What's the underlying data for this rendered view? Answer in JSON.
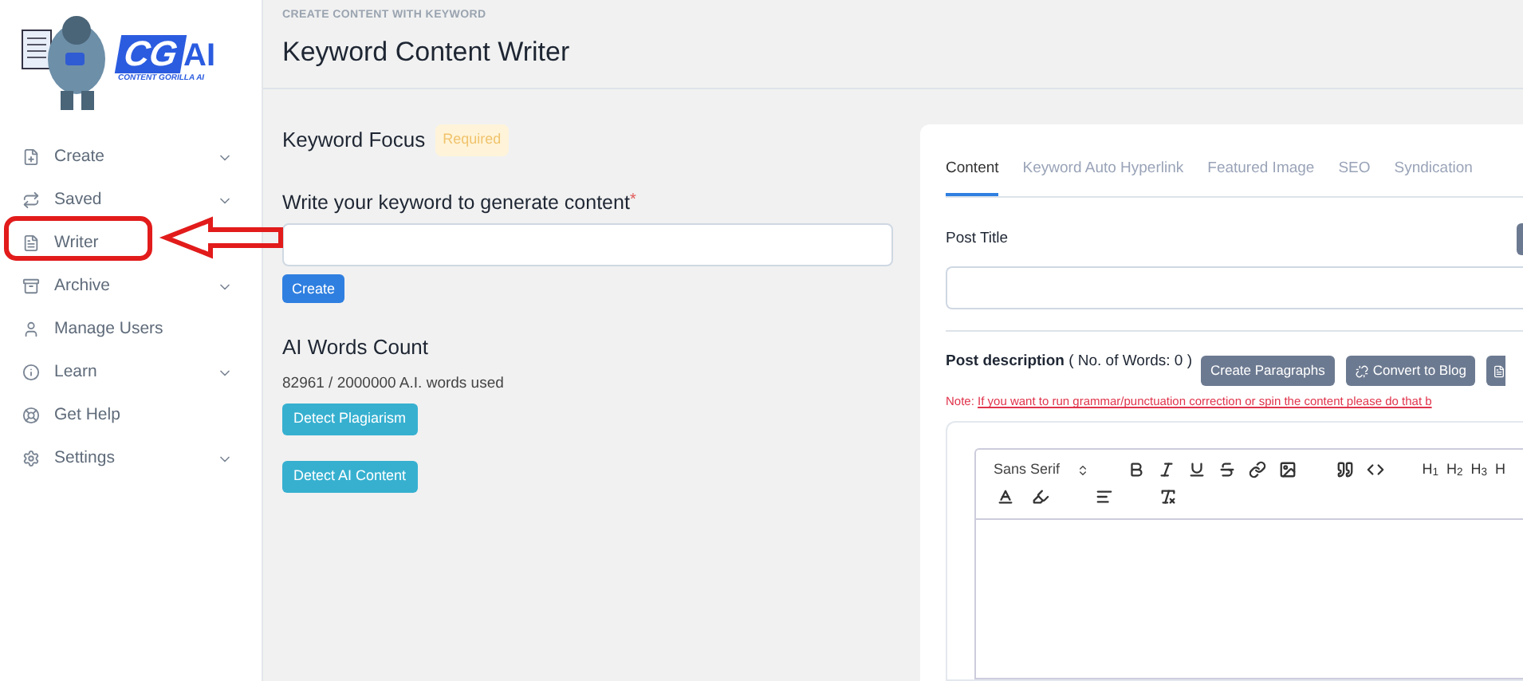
{
  "logo": {
    "mark": "CG",
    "suffix": "AI",
    "tagline": "CONTENT GORILLA AI"
  },
  "sidebar": {
    "items": [
      {
        "label": "Create",
        "has_submenu": true
      },
      {
        "label": "Saved",
        "has_submenu": true
      },
      {
        "label": "Writer",
        "has_submenu": false
      },
      {
        "label": "Archive",
        "has_submenu": true
      },
      {
        "label": "Manage Users",
        "has_submenu": false
      },
      {
        "label": "Learn",
        "has_submenu": true
      },
      {
        "label": "Get Help",
        "has_submenu": false
      },
      {
        "label": "Settings",
        "has_submenu": true
      }
    ]
  },
  "header": {
    "overline": "CREATE CONTENT WITH KEYWORD",
    "title": "Keyword Content Writer"
  },
  "keyword_focus": {
    "title": "Keyword Focus",
    "badge": "Required",
    "field_label": "Write your keyword to generate content",
    "required_mark": "*",
    "create_button": "Create"
  },
  "words_count": {
    "title": "AI Words Count",
    "usage": "82961 / 2000000 A.I. words used",
    "buttons": [
      "Detect Plagiarism",
      "Detect AI Content"
    ]
  },
  "editor_panel": {
    "tabs": [
      {
        "label": "Content",
        "selected": true
      },
      {
        "label": "Keyword Auto Hyperlink",
        "selected": false
      },
      {
        "label": "Featured Image",
        "selected": false
      },
      {
        "label": "SEO",
        "selected": false
      },
      {
        "label": "Syndication",
        "selected": false
      }
    ],
    "post_title_label": "Post Title",
    "description_label": "Post description",
    "description_count": "( No. of Words: 0 )",
    "actions": [
      {
        "label": "Create Paragraphs",
        "kind": "plain"
      },
      {
        "label": "Convert to Blog",
        "kind": "with_icon"
      }
    ],
    "note_prefix": "Note:",
    "note_text": "If you want to run grammar/punctuation correction or spin the content please do that b",
    "font_select": "Sans Serif",
    "headers": [
      "H$_{1}$",
      "H$_{2}$",
      "H$_{3}$",
      "H"
    ]
  }
}
